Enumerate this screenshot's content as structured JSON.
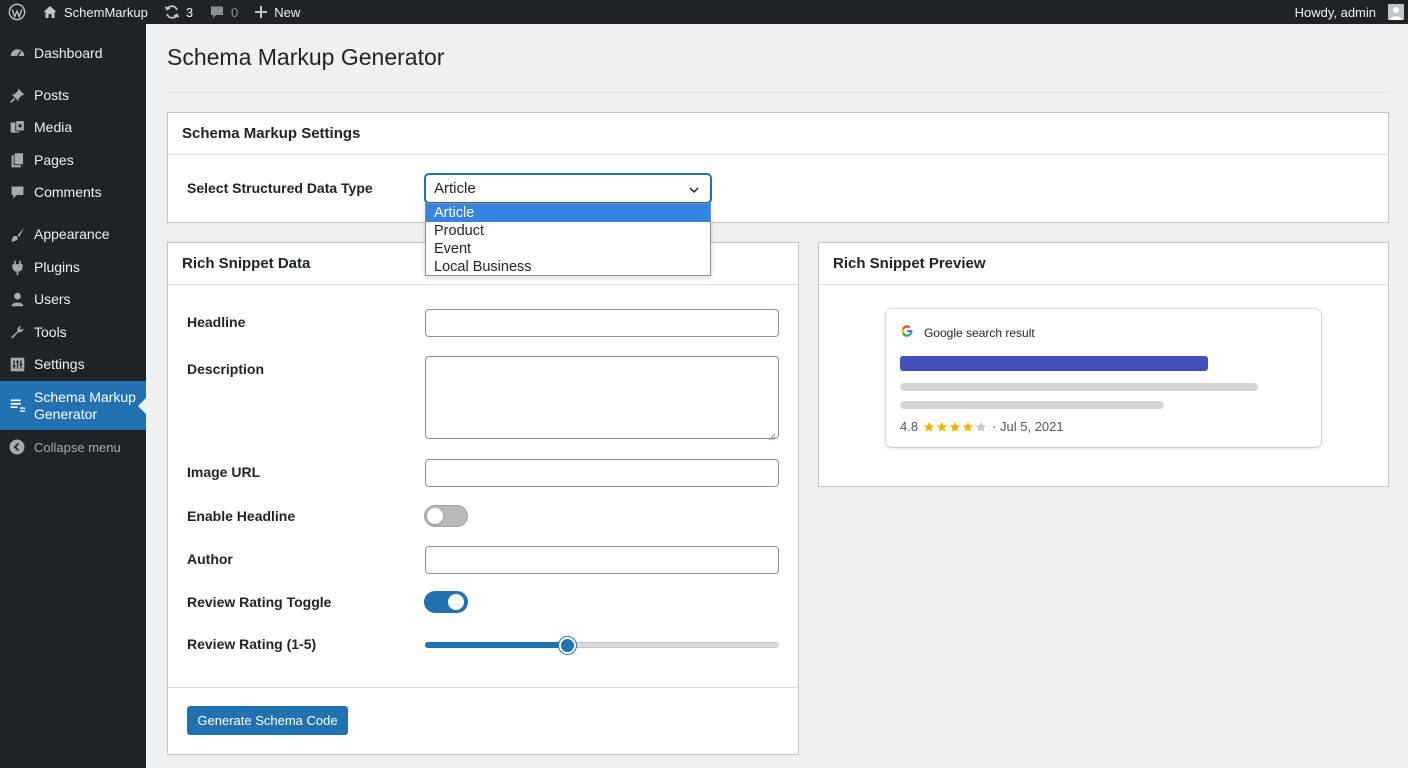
{
  "adminbar": {
    "site_name": "SchemMarkup",
    "updates_count": "3",
    "comments_count": "0",
    "new_label": "New",
    "greeting": "Howdy, admin"
  },
  "sidebar": {
    "items": [
      {
        "label": "Dashboard",
        "icon": "dashboard-icon"
      },
      {
        "label": "Posts",
        "icon": "pushpin-icon"
      },
      {
        "label": "Media",
        "icon": "media-icon"
      },
      {
        "label": "Pages",
        "icon": "pages-icon"
      },
      {
        "label": "Comments",
        "icon": "comment-icon"
      },
      {
        "label": "Appearance",
        "icon": "paintbrush-icon"
      },
      {
        "label": "Plugins",
        "icon": "plugin-icon"
      },
      {
        "label": "Users",
        "icon": "user-icon"
      },
      {
        "label": "Tools",
        "icon": "wrench-icon"
      },
      {
        "label": "Settings",
        "icon": "settings-icon"
      },
      {
        "label_line1": "Schema Markup",
        "label_line2": "Generator",
        "icon": "schema-list-icon",
        "active": true
      }
    ],
    "collapse_label": "Collapse menu"
  },
  "page": {
    "title": "Schema Markup Generator"
  },
  "settings_card": {
    "title": "Schema Markup Settings",
    "select_label": "Select Structured Data Type",
    "selected_value": "Article",
    "options": [
      "Article",
      "Product",
      "Event",
      "Local Business"
    ]
  },
  "snippet_card": {
    "title": "Rich Snippet Data",
    "headline_label": "Headline",
    "headline_value": "",
    "description_label": "Description",
    "description_value": "",
    "image_url_label": "Image URL",
    "image_url_value": "",
    "enable_headline_label": "Enable Headline",
    "enable_headline_on": false,
    "author_label": "Author",
    "author_value": "",
    "review_toggle_label": "Review Rating Toggle",
    "review_toggle_on": true,
    "review_rating_label": "Review Rating (1-5)",
    "review_rating_fraction": 0.4,
    "generate_button": "Generate Schema Code"
  },
  "preview_card": {
    "title": "Rich Snippet Preview",
    "source_label": "Google search result",
    "rating_value": "4.8",
    "stars_filled": 4,
    "stars_total": 5,
    "date_text": "· Jul 5, 2021"
  },
  "colors": {
    "accent": "#2271b1",
    "sidebar_bg": "#1d2327",
    "preview_title_bar": "#4450b8",
    "star": "#f0b400"
  }
}
